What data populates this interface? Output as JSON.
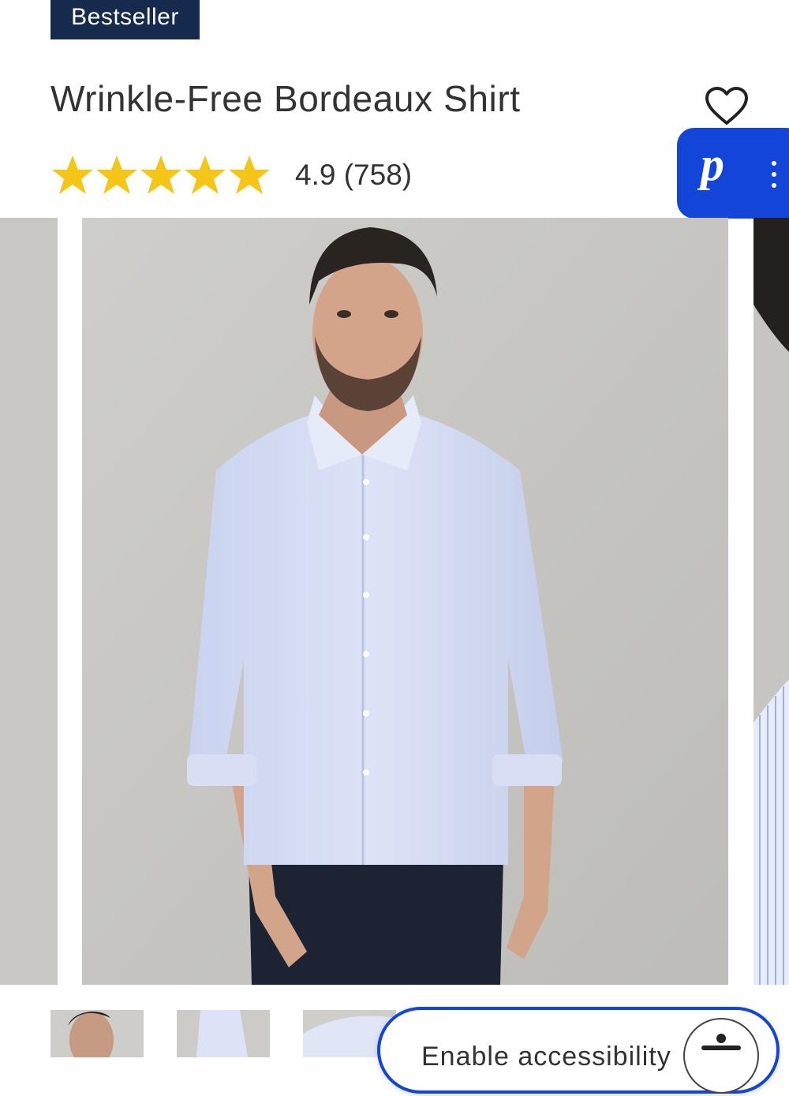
{
  "badge": {
    "label": "Bestseller"
  },
  "product": {
    "title": "Wrinkle-Free Bordeaux Shirt",
    "rating_text": "4.9 (758)",
    "rating_value": 4.9,
    "review_count": 758,
    "stars_filled": 5
  },
  "wishlist": {
    "icon": "heart-outline-icon"
  },
  "floating_widget": {
    "letter": "p",
    "icon": "more-vertical-icon",
    "color": "#1346d8"
  },
  "gallery": {
    "current_image": "man-in-light-blue-dress-shirt"
  },
  "accessibility": {
    "label": "Enable accessibility",
    "icon": "accessibility-person-icon"
  },
  "colors": {
    "badge_bg": "#152a4c",
    "star": "#f5c518",
    "accent": "#1346d8"
  }
}
